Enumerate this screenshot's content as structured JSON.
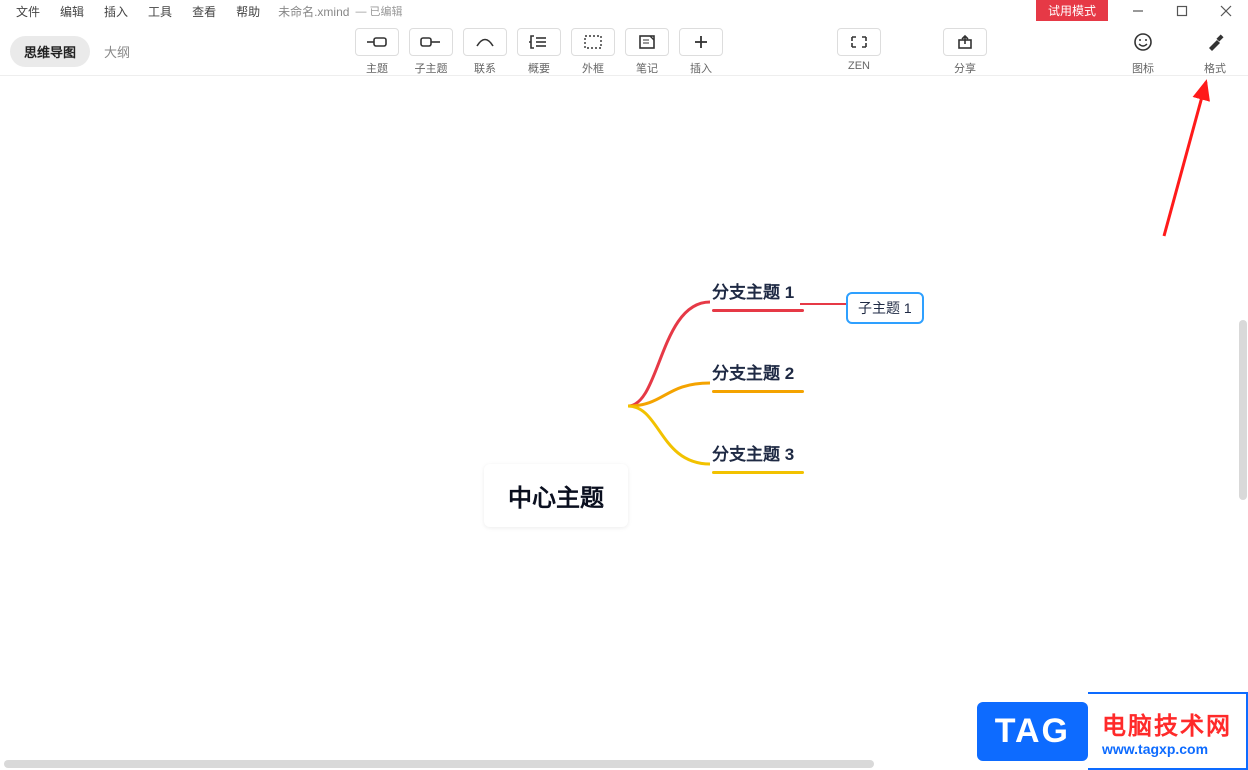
{
  "menu": {
    "file": "文件",
    "edit": "编辑",
    "insert": "插入",
    "tools": "工具",
    "view": "查看",
    "help": "帮助"
  },
  "document": {
    "name": "未命名.xmind",
    "status": "— 已编辑"
  },
  "trial_badge": "试用模式",
  "window": {
    "min": "min",
    "max": "max",
    "close": "close"
  },
  "view_toggle": {
    "mindmap": "思维导图",
    "outline": "大纲"
  },
  "toolbar": {
    "topic": "主题",
    "subtopic": "子主题",
    "relation": "联系",
    "summary": "概要",
    "boundary": "外框",
    "notes": "笔记",
    "insert": "插入",
    "zen": "ZEN",
    "share": "分享",
    "icons": "图标",
    "format": "格式"
  },
  "mindmap": {
    "center": "中心主题",
    "branches": [
      "分支主题 1",
      "分支主题 2",
      "分支主题 3"
    ],
    "subnode": "子主题 1"
  },
  "watermark": {
    "tag": "TAG",
    "line1": "电脑技术网",
    "line2": "www.tagxp.com"
  }
}
